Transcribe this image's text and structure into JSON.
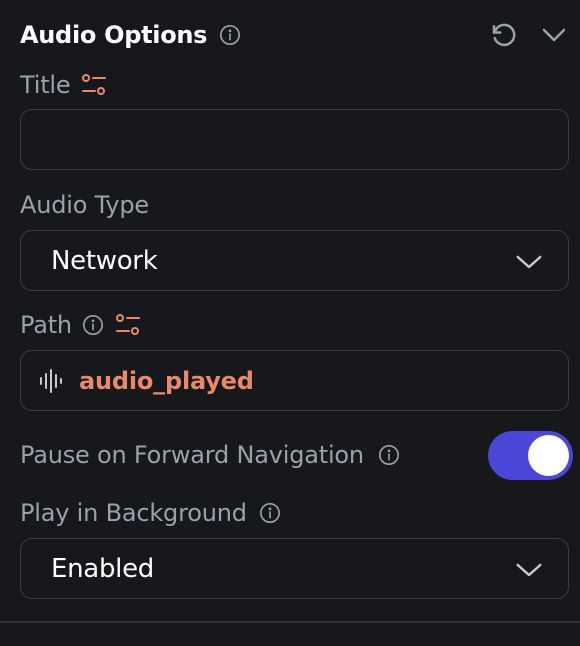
{
  "header": {
    "title": "Audio Options"
  },
  "title_field": {
    "label": "Title",
    "value": ""
  },
  "audio_type": {
    "label": "Audio Type",
    "selected": "Network"
  },
  "path": {
    "label": "Path",
    "value": "audio_played"
  },
  "pause_on_forward": {
    "label": "Pause on Forward Navigation",
    "enabled": true
  },
  "play_in_background": {
    "label": "Play in Background",
    "selected": "Enabled"
  },
  "icons": {
    "info": "info-circle-icon",
    "reset": "reset-icon",
    "collapse": "chevron-down-icon",
    "variable": "variable-icon",
    "waveform": "audio-waveform-icon"
  },
  "colors": {
    "background": "#17181c",
    "border": "#3b3d44",
    "label": "#9ca0a8",
    "accent": "#e9896a",
    "toggle": "#4a46d6"
  }
}
